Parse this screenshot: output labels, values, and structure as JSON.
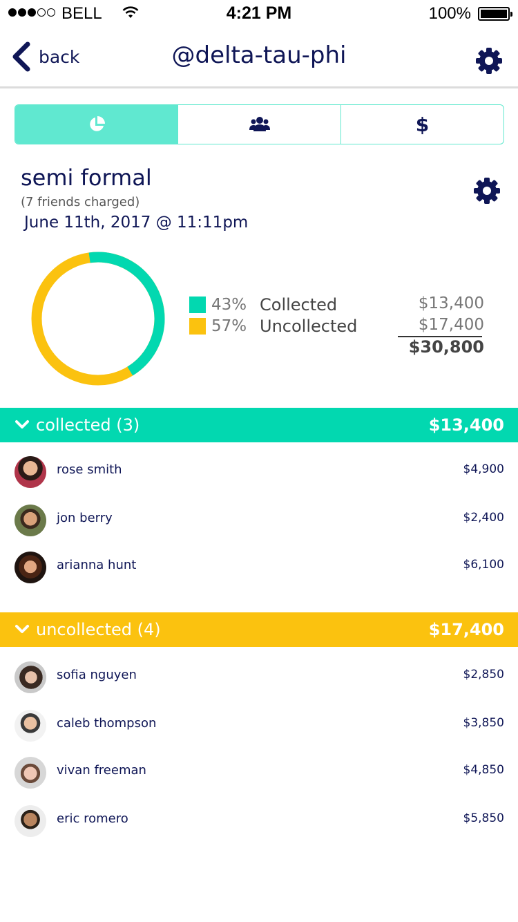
{
  "status_bar": {
    "carrier": "BELL",
    "time": "4:21 PM",
    "battery": "100%"
  },
  "nav": {
    "back_label": "back",
    "title": "@delta-tau-phi"
  },
  "tabs": {
    "dollar_label": "$"
  },
  "event": {
    "name": "semi formal",
    "subtitle": "(7 friends charged)",
    "date": "June 11th, 2017 @ 11:11pm"
  },
  "summary": {
    "collected_pct": "43%",
    "collected_label": "Collected",
    "collected_amount": "$13,400",
    "uncollected_pct": "57%",
    "uncollected_label": "Uncollected",
    "uncollected_amount": "$17,400",
    "total": "$30,800",
    "collected_fraction": 0.435
  },
  "colors": {
    "collected": "#02d8b0",
    "uncollected": "#fbc20f",
    "navy": "#0f1656"
  },
  "collected": {
    "title": "collected (3)",
    "total": "$13,400",
    "people": [
      {
        "name": "rose smith",
        "amount": "$4,900"
      },
      {
        "name": "jon berry",
        "amount": "$2,400"
      },
      {
        "name": "arianna hunt",
        "amount": "$6,100"
      }
    ]
  },
  "uncollected": {
    "title": "uncollected (4)",
    "total": "$17,400",
    "people": [
      {
        "name": "sofia nguyen",
        "amount": "$2,850"
      },
      {
        "name": "caleb thompson",
        "amount": "$3,850"
      },
      {
        "name": "vivan freeman",
        "amount": "$4,850"
      },
      {
        "name": "eric romero",
        "amount": "$5,850"
      }
    ]
  }
}
